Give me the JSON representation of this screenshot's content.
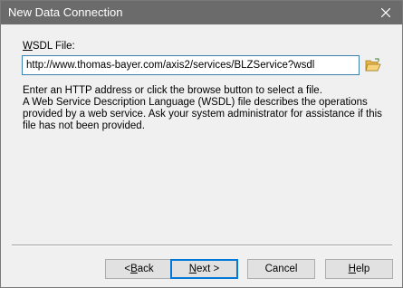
{
  "window": {
    "title": "New Data Connection",
    "close_icon": "close-icon"
  },
  "wsdl": {
    "label_mnemonic": "W",
    "label_rest": "SDL File:",
    "value": "http://www.thomas-bayer.com/axis2/services/BLZService?wsdl",
    "browse_icon": "folder-open-icon"
  },
  "help": {
    "line1": "Enter an HTTP address or click the browse button to select a file.",
    "line2": "A Web Service Description Language (WSDL) file describes the operations provided by a web service.  Ask your system administrator for assistance if this file has not been provided."
  },
  "buttons": {
    "back_prefix": "< ",
    "back_mnemonic": "B",
    "back_rest": "ack",
    "next_mnemonic": "N",
    "next_rest": "ext >",
    "cancel": "Cancel",
    "help_mnemonic": "H",
    "help_rest": "elp"
  },
  "colors": {
    "titlebar": "#6b6b6b",
    "input_border": "#3c7fb1",
    "default_button_border": "#0078d7"
  }
}
